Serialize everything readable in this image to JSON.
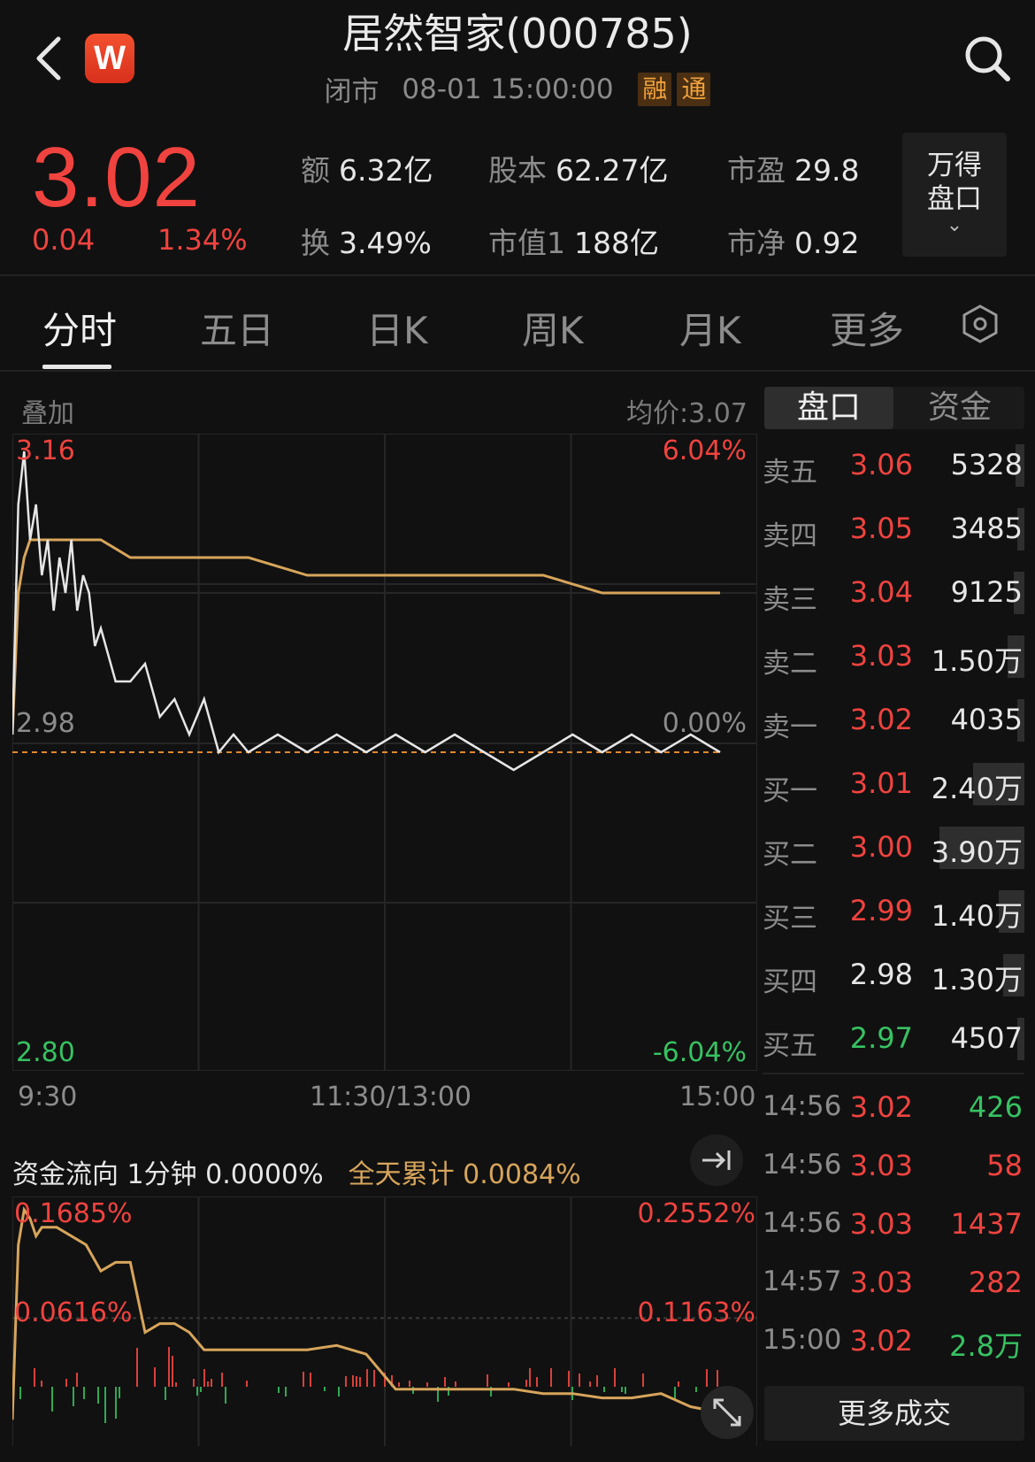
{
  "header": {
    "title": "居然智家(000785)",
    "status": "闭市",
    "datetime": "08-01 15:00:00",
    "badges": [
      "融",
      "通"
    ],
    "logo_letter": "W"
  },
  "quote": {
    "price": "3.02",
    "change": "0.04",
    "change_pct": "1.34%",
    "stats": [
      {
        "label": "额",
        "value": "6.32亿"
      },
      {
        "label": "股本",
        "value": "62.27亿"
      },
      {
        "label": "市盈",
        "value": "29.8"
      },
      {
        "label": "换",
        "value": "3.49%"
      },
      {
        "label": "市值1",
        "value": "188亿"
      },
      {
        "label": "市净",
        "value": "0.92"
      }
    ],
    "wind_button": {
      "line1": "万得",
      "line2": "盘口"
    }
  },
  "tabs": [
    "分时",
    "五日",
    "日K",
    "周K",
    "月K",
    "更多"
  ],
  "chart": {
    "overlay_label": "叠加",
    "avg_price": "均价:3.07",
    "y_max": "3.16",
    "y_mid": "2.98",
    "y_min": "2.80",
    "pct_max": "6.04%",
    "pct_mid": "0.00%",
    "pct_min": "-6.04%",
    "x_labels": [
      "9:30",
      "11:30/13:00",
      "15:00"
    ]
  },
  "chart_data": {
    "type": "line",
    "x_range": [
      "9:30",
      "15:00"
    ],
    "ylim": [
      2.8,
      3.16
    ],
    "reference_price": 2.98,
    "series": [
      {
        "name": "price",
        "color": "#e6e6e6",
        "x": [
          0,
          2,
          4,
          6,
          8,
          10,
          12,
          14,
          16,
          18,
          20,
          22,
          24,
          26,
          28,
          30,
          35,
          40,
          45,
          50,
          55,
          60,
          65,
          70,
          75,
          80,
          90,
          100,
          110,
          120,
          130,
          140,
          150,
          160,
          170,
          180,
          190,
          200,
          210,
          220,
          230,
          240
        ],
        "values": [
          2.99,
          3.12,
          3.15,
          3.1,
          3.12,
          3.08,
          3.1,
          3.06,
          3.09,
          3.07,
          3.1,
          3.06,
          3.08,
          3.07,
          3.04,
          3.05,
          3.02,
          3.02,
          3.03,
          3.0,
          3.01,
          2.99,
          3.01,
          2.98,
          2.99,
          2.98,
          2.99,
          2.98,
          2.99,
          2.98,
          2.99,
          2.98,
          2.99,
          2.98,
          2.97,
          2.98,
          2.99,
          2.98,
          2.99,
          2.98,
          2.99,
          2.98
        ]
      },
      {
        "name": "avg",
        "color": "#d7a55b",
        "x": [
          0,
          2,
          4,
          6,
          10,
          20,
          30,
          40,
          60,
          80,
          100,
          120,
          140,
          160,
          180,
          200,
          220,
          240
        ],
        "values": [
          2.99,
          3.07,
          3.09,
          3.1,
          3.1,
          3.1,
          3.1,
          3.09,
          3.09,
          3.09,
          3.08,
          3.08,
          3.08,
          3.08,
          3.08,
          3.07,
          3.07,
          3.07
        ]
      }
    ]
  },
  "panel_tabs": [
    "盘口",
    "资金"
  ],
  "order_book": [
    {
      "label": "卖五",
      "price": "3.06",
      "vol": "5328",
      "color": "#f0433f",
      "share": 0.1
    },
    {
      "label": "卖四",
      "price": "3.05",
      "vol": "3485",
      "color": "#f0433f",
      "share": 0.06
    },
    {
      "label": "卖三",
      "price": "3.04",
      "vol": "9125",
      "color": "#f0433f",
      "share": 0.12
    },
    {
      "label": "卖二",
      "price": "3.03",
      "vol": "1.50万",
      "color": "#f0433f",
      "share": 0.2
    },
    {
      "label": "卖一",
      "price": "3.02",
      "vol": "4035",
      "color": "#f0433f",
      "share": 0.08
    },
    {
      "label": "买一",
      "price": "3.01",
      "vol": "2.40万",
      "color": "#f0433f",
      "share": 0.6
    },
    {
      "label": "买二",
      "price": "3.00",
      "vol": "3.90万",
      "color": "#f0433f",
      "share": 1.0
    },
    {
      "label": "买三",
      "price": "2.99",
      "vol": "1.40万",
      "color": "#f0433f",
      "share": 0.3
    },
    {
      "label": "买四",
      "price": "2.98",
      "vol": "1.30万",
      "color": "#e6e6e6",
      "share": 0.25
    },
    {
      "label": "买五",
      "price": "2.97",
      "vol": "4507",
      "color": "#37c262",
      "share": 0.08
    }
  ],
  "trades": [
    {
      "time": "14:56",
      "price": "3.02",
      "vol": "426",
      "price_color": "#f0433f",
      "vol_color": "#37c262"
    },
    {
      "time": "14:56",
      "price": "3.03",
      "vol": "58",
      "price_color": "#f0433f",
      "vol_color": "#f0433f"
    },
    {
      "time": "14:56",
      "price": "3.03",
      "vol": "1437",
      "price_color": "#f0433f",
      "vol_color": "#f0433f"
    },
    {
      "time": "14:57",
      "price": "3.03",
      "vol": "282",
      "price_color": "#f0433f",
      "vol_color": "#f0433f"
    },
    {
      "time": "15:00",
      "price": "3.02",
      "vol": "2.8万",
      "price_color": "#f0433f",
      "vol_color": "#37c262"
    }
  ],
  "more_trades": "更多成交",
  "flow": {
    "title": "资金流向 1分钟 0.0000%",
    "cumulative": "全天累计 0.0084%",
    "left_top": "0.1685%",
    "left_mid": "0.0616%",
    "right_top": "0.2552%",
    "right_mid": "0.1163%"
  },
  "flow_data": {
    "type": "line",
    "ylim": [
      -0.03,
      0.2552
    ],
    "x": [
      0,
      2,
      4,
      6,
      8,
      10,
      15,
      20,
      25,
      30,
      35,
      40,
      45,
      50,
      55,
      60,
      65,
      70,
      80,
      90,
      100,
      110,
      120,
      130,
      140,
      150,
      160,
      170,
      180,
      190,
      200,
      210,
      220,
      230,
      240
    ],
    "values": [
      0.0,
      0.2,
      0.24,
      0.23,
      0.21,
      0.22,
      0.22,
      0.21,
      0.2,
      0.17,
      0.18,
      0.18,
      0.1,
      0.11,
      0.11,
      0.1,
      0.08,
      0.08,
      0.08,
      0.08,
      0.08,
      0.085,
      0.075,
      0.035,
      0.035,
      0.035,
      0.035,
      0.035,
      0.03,
      0.03,
      0.025,
      0.025,
      0.03,
      0.015,
      0.0084
    ]
  }
}
